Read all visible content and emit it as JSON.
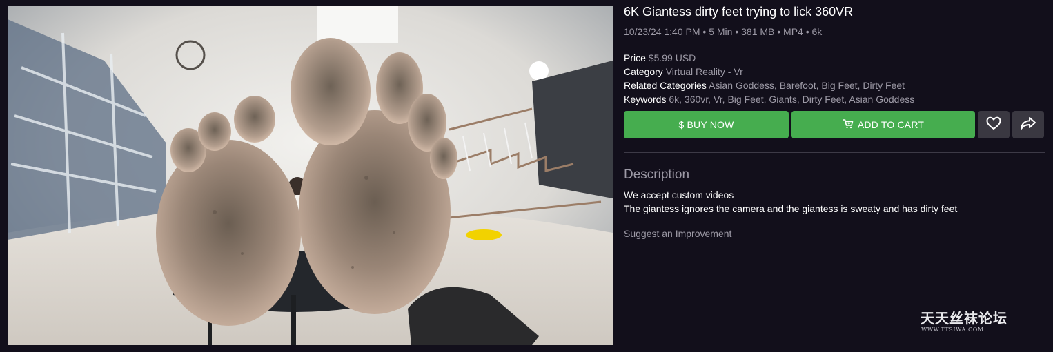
{
  "video": {
    "title": "6K Giantess dirty feet trying to lick 360VR",
    "meta": "10/23/24 1:40 PM • 5 Min • 381 MB • MP4 • 6k",
    "thumbnail_icon": "video-thumbnail"
  },
  "details": {
    "price_label": "Price",
    "price_value": "$5.99 USD",
    "category_label": "Category",
    "category_value": "Virtual Reality - Vr",
    "related_label": "Related Categories",
    "related_value": "Asian Goddess, Barefoot, Big Feet, Dirty Feet",
    "keywords_label": "Keywords",
    "keywords_value": "6k, 360vr, Vr, Big Feet, Giants, Dirty Feet, Asian Goddess"
  },
  "actions": {
    "buy_label": "$ BUY NOW",
    "cart_label": "ADD TO CART",
    "cart_icon": "cart-icon",
    "favorite_icon": "heart-icon",
    "share_icon": "share-icon"
  },
  "description": {
    "heading": "Description",
    "line1": "We accept custom videos",
    "line2": "The giantess ignores the camera and the giantess is sweaty and has dirty feet",
    "suggest": "Suggest an Improvement"
  },
  "watermark": {
    "title": "天天丝袜论坛",
    "url": "WWW.TTSIWA.COM"
  },
  "colors": {
    "background": "#120f1b",
    "accent_green": "#46ad4f",
    "muted_text": "#9d9aa6",
    "icon_button": "#3a3841"
  }
}
